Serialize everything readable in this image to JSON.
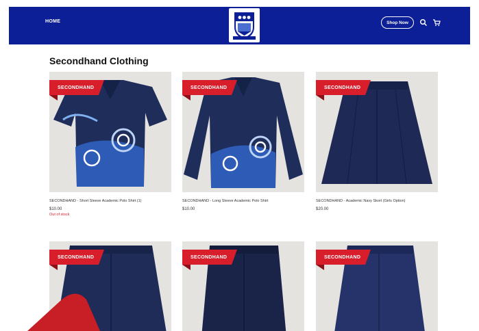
{
  "header": {
    "nav_home": "HOME",
    "shop_now": "Shop Now",
    "brand_color": "#0d1f96",
    "icons": [
      "search-icon",
      "cart-icon"
    ]
  },
  "page": {
    "title": "Secondhand Clothing",
    "badge": "SECONDHAND",
    "badge_color": "#d81e2a"
  },
  "products": [
    {
      "name": "SECONDHAND - Short Sleeve Academic Polo Shirt (1)",
      "price": "$10.00",
      "stock": "Out of stock"
    },
    {
      "name": "SECONDHAND - Long Sleeve Academic Polo Shirt",
      "price": "$10.00",
      "stock": ""
    },
    {
      "name": "SECONDHAND - Academic Navy Skort (Girls Option)",
      "price": "$20.00",
      "stock": ""
    }
  ]
}
